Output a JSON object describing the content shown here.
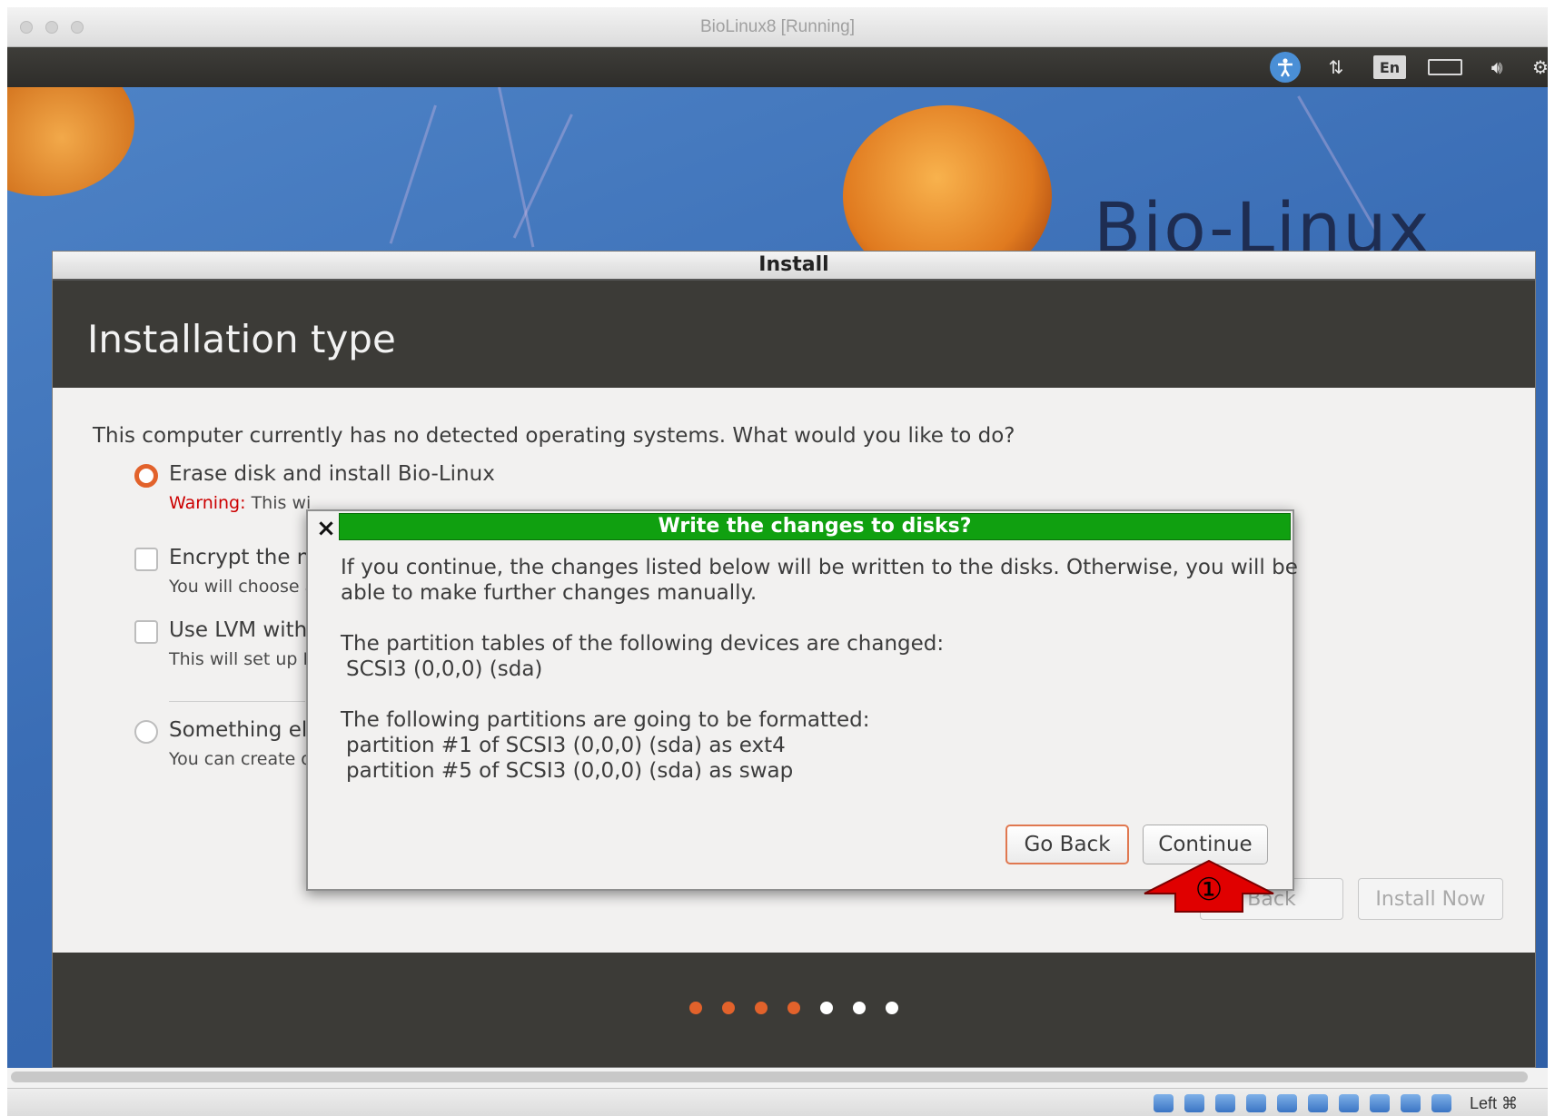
{
  "host_window": {
    "title": "BioLinux8 [Running]",
    "status_host_key": "Left ⌘"
  },
  "guest_panel": {
    "keyboard_indicator": "En",
    "icons": [
      "accessibility-icon",
      "network-icon",
      "keyboard-layout-icon",
      "battery-icon",
      "volume-icon",
      "settings-icon"
    ]
  },
  "desktop": {
    "brand_text": "Bio-Linux"
  },
  "installer": {
    "window_title": "Install",
    "header_title": "Installation type",
    "question": "This computer currently has no detected operating systems. What would you like to do?",
    "options": [
      {
        "label": "Erase disk and install Bio-Linux",
        "desc_warning": "Warning:",
        "desc": "This wi"
      },
      {
        "label": "Encrypt the n",
        "desc": "You will choose a"
      },
      {
        "label": "Use LVM with",
        "desc": "This will set up L"
      },
      {
        "label": "Something el",
        "desc": "You can create o"
      }
    ],
    "buttons": {
      "back": "Back",
      "install_now": "Install Now"
    },
    "progress": {
      "completed": 4,
      "total": 7
    },
    "colors": {
      "accent": "#e2622b",
      "header_bg": "#3c3b37"
    }
  },
  "dialog": {
    "title": "Write the changes to disks?",
    "close_glyph": "×",
    "intro_line1": "If you continue, the changes listed below will be written to the disks. Otherwise, you will be",
    "intro_line2": "able to make further changes manually.",
    "tables_heading": "The partition tables of the following devices are changed:",
    "tables_device": "SCSI3 (0,0,0) (sda)",
    "format_heading": "The following partitions are going to be formatted:",
    "format_items": [
      "partition #1 of SCSI3 (0,0,0) (sda) as ext4",
      "partition #5 of SCSI3 (0,0,0) (sda) as swap"
    ],
    "go_back_label": "Go Back",
    "continue_label": "Continue",
    "title_color": "#10a010"
  },
  "annotation": {
    "step_marker": "①",
    "color": "#e00000"
  }
}
